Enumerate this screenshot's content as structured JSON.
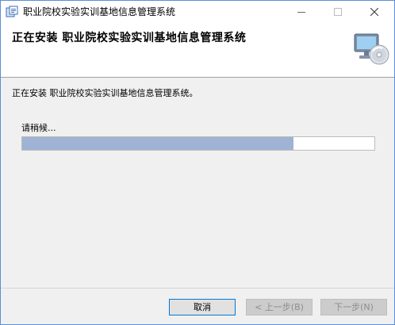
{
  "window": {
    "title": "职业院校实验实训基地信息管理系统",
    "controls": {
      "minimize_icon": "minimize-icon",
      "maximize_icon": "maximize-icon",
      "close_icon": "close-icon"
    }
  },
  "banner": {
    "title": "正在安装 职业院校实验实训基地信息管理系统",
    "icon": "computer-setup-icon"
  },
  "body": {
    "status": "正在安装 职业院校实验实训基地信息管理系统。",
    "wait_label": "请稍候...",
    "progress_fraction": 0.77
  },
  "footer": {
    "cancel_label": "取消",
    "back_label": "< 上一步(B)",
    "next_label": "下一步(N)"
  },
  "colors": {
    "progress_fill": "#9fb3d4",
    "window_border": "#5a8fd6",
    "default_button_border": "#0078d7"
  }
}
